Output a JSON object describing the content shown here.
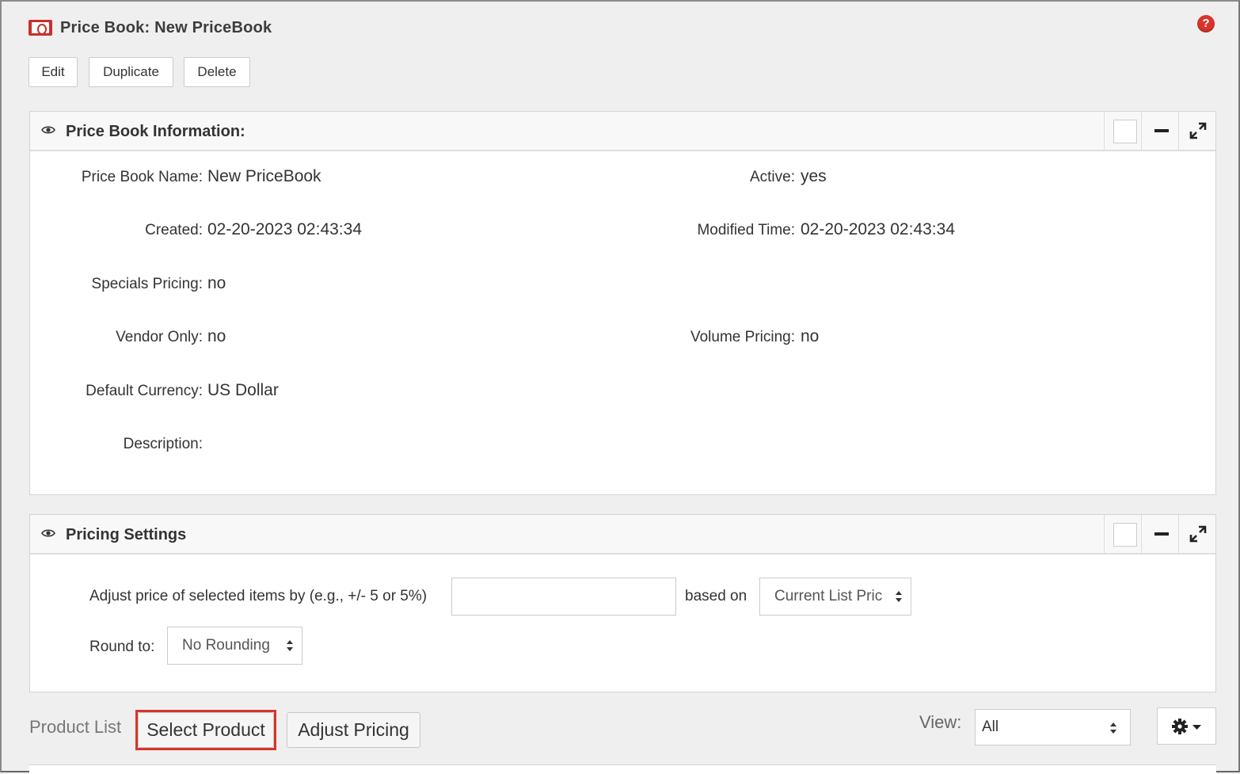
{
  "page": {
    "title": "Price Book: New PriceBook",
    "help_icon": "question-circle-icon",
    "accent_color": "#d9342b"
  },
  "actions": {
    "edit": "Edit",
    "duplicate": "Duplicate",
    "delete": "Delete"
  },
  "info_panel": {
    "title": "Price Book Information:",
    "fields": {
      "name": {
        "label": "Price Book Name:",
        "value": "New PriceBook"
      },
      "active": {
        "label": "Active:",
        "value": "yes"
      },
      "created": {
        "label": "Created:",
        "value": "02-20-2023 02:43:34"
      },
      "modified": {
        "label": "Modified Time:",
        "value": "02-20-2023 02:43:34"
      },
      "specials": {
        "label": "Specials Pricing:",
        "value": "no"
      },
      "vendor_only": {
        "label": "Vendor Only:",
        "value": "no"
      },
      "volume": {
        "label": "Volume Pricing:",
        "value": "no"
      },
      "currency": {
        "label": "Default Currency:",
        "value": "US Dollar"
      },
      "description": {
        "label": "Description:",
        "value": ""
      }
    }
  },
  "pricing_panel": {
    "title": "Pricing Settings",
    "adjust_label": "Adjust price of selected items by (e.g., +/- 5 or 5%)",
    "adjust_value": "",
    "based_on_label": "based on",
    "based_on_value": "Current List Pric",
    "round_label": "Round to:",
    "round_value": "No Rounding"
  },
  "product_list": {
    "label": "Product List",
    "select_product": "Select Product",
    "adjust_pricing": "Adjust Pricing",
    "view_label": "View:",
    "view_value": "All",
    "settings_icon": "gear-icon"
  }
}
